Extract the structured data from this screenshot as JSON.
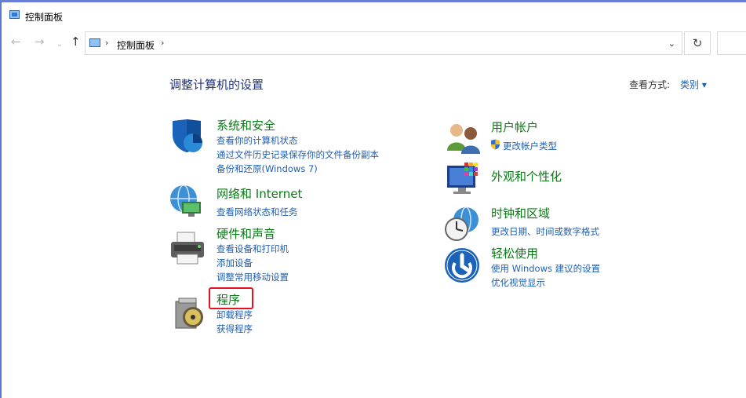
{
  "window": {
    "title": "控制面板"
  },
  "nav": {
    "back_icon": "arrow-left-icon",
    "forward_icon": "arrow-right-icon",
    "recent_icon": "chevron-down-icon",
    "up_icon": "arrow-up-icon"
  },
  "address": {
    "path": "控制面板",
    "separator": "›",
    "dropdown_glyph": "⌄",
    "refresh_glyph": "↻"
  },
  "main": {
    "heading": "调整计算机的设置",
    "view_by_label": "查看方式:",
    "view_by_value": "类别 ▾"
  },
  "categories": [
    {
      "title": "系统和安全",
      "icon": "shield-icon",
      "links": [
        "查看你的计算机状态",
        "通过文件历史记录保存你的文件备份副本",
        "备份和还原(Windows 7)"
      ]
    },
    {
      "title": "网络和 Internet",
      "icon": "globe-network-icon",
      "links": [
        "查看网络状态和任务"
      ]
    },
    {
      "title": "硬件和声音",
      "icon": "printer-icon",
      "links": [
        "查看设备和打印机",
        "添加设备",
        "调整常用移动设置"
      ]
    },
    {
      "title": "程序",
      "icon": "programs-disc-icon",
      "links": [
        "卸载程序",
        "获得程序"
      ]
    },
    {
      "title": "用户帐户",
      "icon": "users-icon",
      "links": [
        "更改帐户类型"
      ]
    },
    {
      "title": "外观和个性化",
      "icon": "monitor-palette-icon",
      "links": []
    },
    {
      "title": "时钟和区域",
      "icon": "clock-globe-icon",
      "links": [
        "更改日期、时间或数字格式"
      ]
    },
    {
      "title": "轻松使用",
      "icon": "accessibility-icon",
      "links": [
        "使用 Windows 建议的设置",
        "优化视觉显示"
      ]
    }
  ],
  "colors": {
    "category_title": "#0a7a15",
    "link": "#1f5fb0",
    "heading": "#1e3287",
    "highlight_border": "#e81123"
  }
}
